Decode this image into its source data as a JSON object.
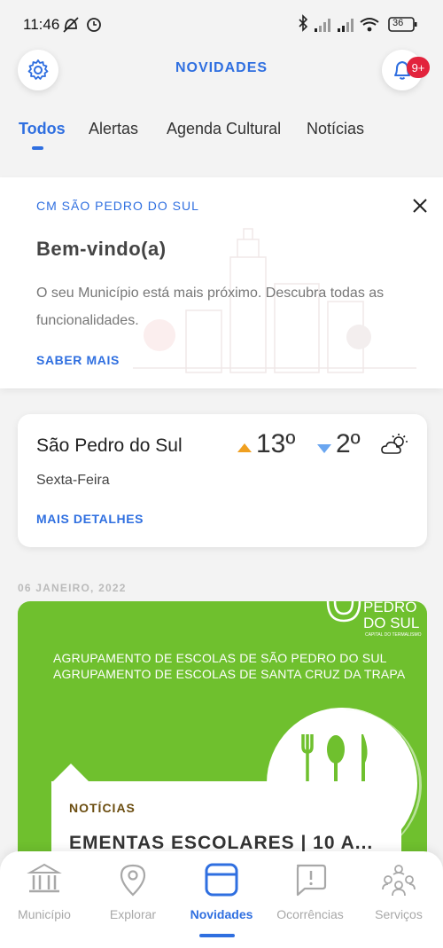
{
  "status_bar": {
    "time": "11:46",
    "battery": "36"
  },
  "header": {
    "title": "NOVIDADES",
    "notification_badge": "9+",
    "settings_icon": "gear-icon",
    "bell_icon": "bell-icon"
  },
  "tabs": [
    {
      "label": "Todos",
      "active": true
    },
    {
      "label": "Alertas",
      "active": false
    },
    {
      "label": "Agenda Cultural",
      "active": false
    },
    {
      "label": "Notícias",
      "active": false
    }
  ],
  "welcome": {
    "label": "CM SÃO PEDRO DO SUL",
    "title": "Bem-vindo(a)",
    "text": "O seu Município está mais próximo. Descubra todas as funcionalidades.",
    "link": "SABER MAIS"
  },
  "weather": {
    "city": "São Pedro do Sul",
    "day": "Sexta-Feira",
    "max": "13º",
    "min": "2º",
    "link": "MAIS DETALHES",
    "icon": "partly-cloudy-icon"
  },
  "feed": {
    "date": "06 JANEIRO, 2022",
    "card": {
      "logo_line1": "PEDRO",
      "logo_line2": "DO SUL",
      "logo_tagline": "CAPITAL DO TERMALISMO",
      "line1": "AGRUPAMENTO DE ESCOLAS DE SÃO PEDRO DO SUL",
      "line2": "AGRUPAMENTO DE ESCOLAS DE SANTA CRUZ DA TRAPA",
      "category": "NOTÍCIAS",
      "title": "EMENTAS ESCOLARES | 10 A..."
    }
  },
  "nav": [
    {
      "label": "Município",
      "icon": "building-icon",
      "active": false
    },
    {
      "label": "Explorar",
      "icon": "map-pin-icon",
      "active": false
    },
    {
      "label": "Novidades",
      "icon": "news-icon",
      "active": true
    },
    {
      "label": "Ocorrências",
      "icon": "alert-icon",
      "active": false
    },
    {
      "label": "Serviços",
      "icon": "people-icon",
      "active": false
    }
  ],
  "colors": {
    "accent": "#2f6fe0",
    "green": "#6fc02e",
    "badge": "#e2233c",
    "up": "#f0a020",
    "down": "#6aa6f0"
  }
}
